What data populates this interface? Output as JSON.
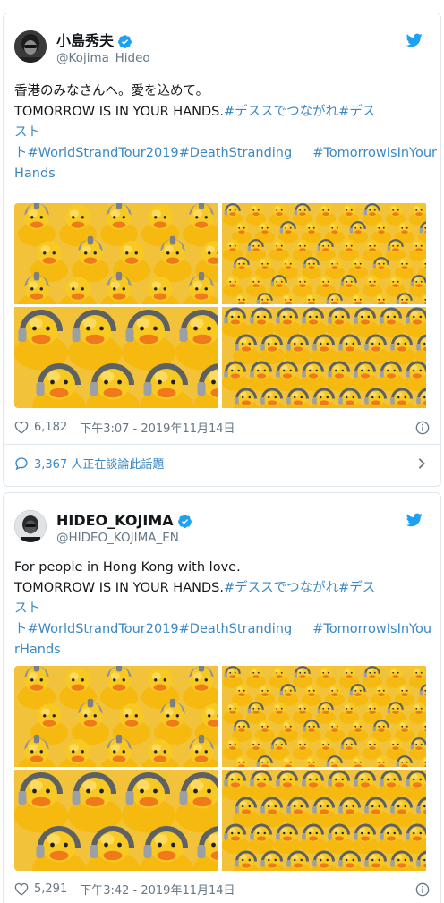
{
  "tweets": [
    {
      "display_name": "小島秀夫",
      "handle": "@Kojima_Hideo",
      "text_lines": [
        [
          {
            "t": "香港のみなさんへ。愛を込めて。",
            "link": false
          }
        ],
        [
          {
            "t": " ",
            "link": false
          }
        ],
        [
          {
            "t": "TOMORROW IS IN YOUR HANDS.",
            "link": false
          },
          {
            "t": "#デススでつながれ",
            "link": true
          },
          {
            "t": "#デス",
            "link": true
          }
        ],
        [
          {
            "t": "スト",
            "link": true
          }
        ],
        [
          {
            "t": "ト#WorldStrandTour2019",
            "link": true
          },
          {
            "t": "#DeathStranding",
            "link": true
          },
          {
            "t": "     ",
            "link": false
          },
          {
            "t": "#TomorrowIsInYour",
            "link": true
          }
        ],
        [
          {
            "t": "Hands",
            "link": true
          }
        ]
      ],
      "likes": "6,182",
      "timestamp": "下午3:07 - 2019年11月14日",
      "conversation": "3,367 人正在談論此話題"
    },
    {
      "display_name": "HIDEO_KOJIMA",
      "handle": "@HIDEO_KOJIMA_EN",
      "text_lines": [
        [
          {
            "t": "For people in Hong Kong with love.",
            "link": false
          }
        ],
        [
          {
            "t": "TOMORROW IS IN YOUR HANDS.",
            "link": false
          },
          {
            "t": "#デススでつながれ",
            "link": true
          },
          {
            "t": "#デス",
            "link": true
          }
        ],
        [
          {
            "t": "スト",
            "link": true
          }
        ],
        [
          {
            "t": "ト#WorldStrandTour2019",
            "link": true
          },
          {
            "t": "#DeathStranding",
            "link": true
          },
          {
            "t": "     ",
            "link": false
          },
          {
            "t": "#TomorrowIsInYou",
            "link": true
          }
        ],
        [
          {
            "t": "rHands",
            "link": true
          }
        ]
      ],
      "likes": "5,291",
      "timestamp": "下午3:42 - 2019年11月14日"
    }
  ],
  "colors": {
    "link": "#3b88c3",
    "twitter_blue": "#1da1f2",
    "meta_gray": "#657786",
    "border": "#e1e8ed",
    "duck_yellow": "#f7c21b"
  },
  "icons": [
    "verified-badge-icon",
    "twitter-bird-icon",
    "heart-icon",
    "info-icon",
    "reply-bubble-icon",
    "chevron-right-icon"
  ]
}
